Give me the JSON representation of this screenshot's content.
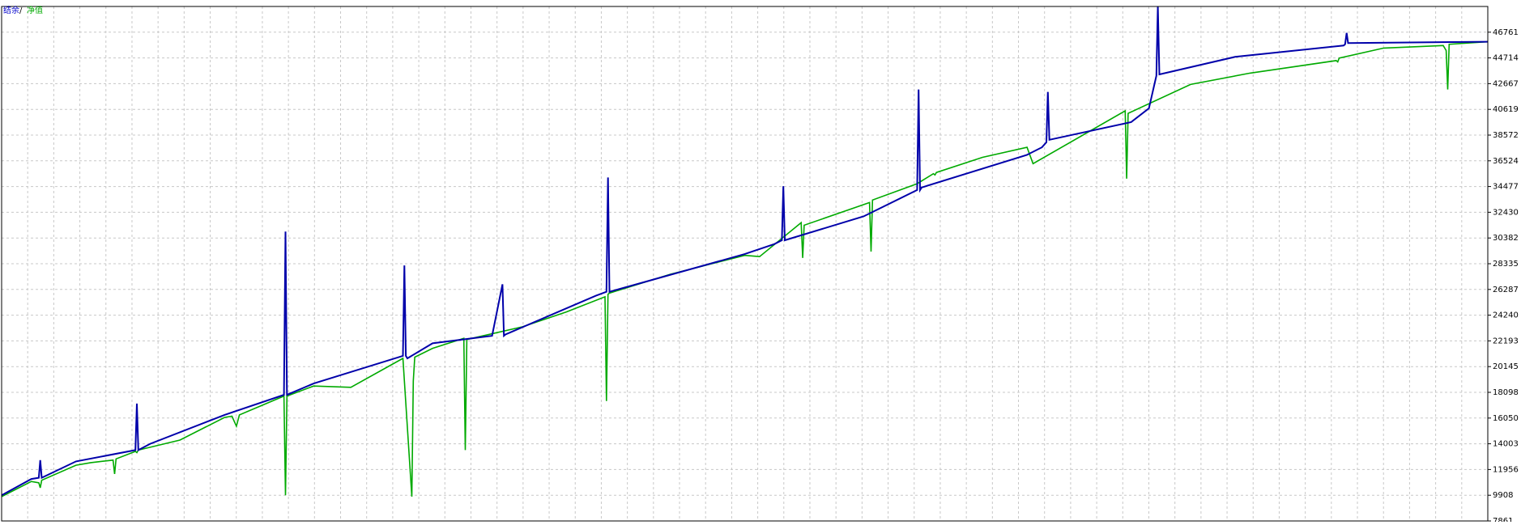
{
  "chart_data": {
    "type": "line",
    "legend": {
      "placement": "top-left",
      "separator": " / ",
      "items": [
        {
          "label": "结余",
          "color": "#0000cc"
        },
        {
          "label": "净值",
          "color": "#00aa00"
        }
      ]
    },
    "x_range": [
      0,
      1000
    ],
    "ylim": [
      7861,
      48808
    ],
    "y_ticks": [
      7861,
      9908,
      11956,
      14003,
      16050,
      18098,
      20145,
      22193,
      24240,
      26287,
      28335,
      30382,
      32430,
      34477,
      36524,
      38572,
      40619,
      42667,
      44714,
      46761
    ],
    "grid": true,
    "colors": {
      "grid": "#c8c8c8",
      "axis": "#000000",
      "balance": "#0000aa",
      "equity": "#00aa00"
    },
    "series": [
      {
        "name": "结余",
        "color": "#0000aa",
        "x": [
          0,
          20,
          25,
          26,
          27,
          50,
          90,
          91,
          92,
          100,
          150,
          190,
          191,
          192,
          210,
          270,
          271,
          272,
          273,
          290,
          330,
          337,
          338,
          339,
          400,
          407,
          408,
          409,
          500,
          520,
          525,
          526,
          527,
          580,
          616,
          617,
          618,
          619,
          690,
          700,
          703,
          704,
          705,
          760,
          772,
          777,
          778,
          779,
          830,
          903,
          904,
          905,
          906,
          1000
        ],
        "y": [
          9900,
          11200,
          11300,
          12700,
          11300,
          12600,
          13500,
          17200,
          13500,
          14000,
          16300,
          17900,
          30900,
          17900,
          18800,
          21000,
          28200,
          21000,
          20800,
          22000,
          22600,
          26700,
          22600,
          22700,
          25800,
          26100,
          35200,
          26100,
          29100,
          29900,
          30200,
          34500,
          30200,
          32100,
          34200,
          42200,
          34200,
          34400,
          37000,
          37600,
          38000,
          42000,
          38200,
          39600,
          40700,
          43300,
          48800,
          43400,
          44800,
          45700,
          45800,
          46700,
          45900,
          46000
        ]
      },
      {
        "name": "净值",
        "color": "#00aa00",
        "x": [
          0,
          20,
          25,
          26,
          27,
          50,
          60,
          75,
          76,
          77,
          90,
          91,
          92,
          120,
          150,
          155,
          158,
          160,
          190,
          191,
          192,
          210,
          235,
          270,
          276,
          277,
          278,
          290,
          311,
          312,
          313,
          350,
          380,
          406,
          407,
          408,
          409,
          450,
          500,
          510,
          538,
          539,
          540,
          584,
          585,
          586,
          616,
          627,
          628,
          629,
          660,
          690,
          694,
          756,
          757,
          758,
          800,
          840,
          898,
          899,
          900,
          930,
          970,
          972,
          973,
          974,
          1000
        ],
        "y": [
          9800,
          11000,
          10900,
          10500,
          11100,
          12300,
          12500,
          12700,
          11600,
          12800,
          13400,
          13300,
          13500,
          14300,
          16100,
          16200,
          15400,
          16300,
          17800,
          9900,
          17800,
          18600,
          18500,
          20800,
          9800,
          19000,
          20900,
          21600,
          22400,
          13500,
          22300,
          23300,
          24500,
          25700,
          17400,
          25900,
          26000,
          27500,
          29000,
          28900,
          31600,
          28800,
          31400,
          33200,
          29300,
          33400,
          34700,
          35500,
          35400,
          35600,
          36800,
          37600,
          36300,
          40500,
          35100,
          40300,
          42600,
          43500,
          44500,
          44400,
          44700,
          45500,
          45700,
          45300,
          42200,
          45800,
          46000
        ]
      }
    ]
  }
}
